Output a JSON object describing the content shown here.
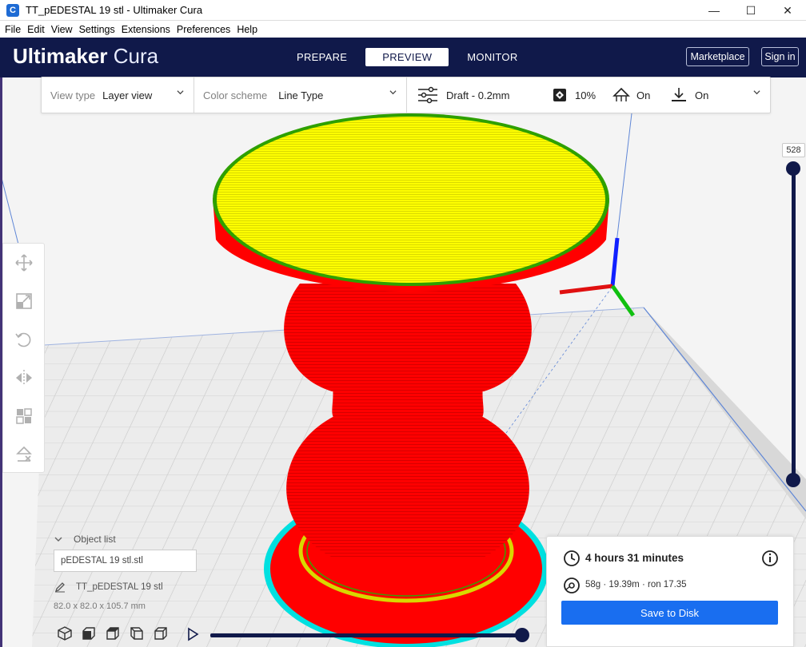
{
  "window": {
    "title": "TT_pEDESTAL 19 stl - Ultimaker Cura",
    "app_icon": "C",
    "minimize": "—",
    "maximize": "☐",
    "close": "✕"
  },
  "menu": [
    "File",
    "Edit",
    "View",
    "Settings",
    "Extensions",
    "Preferences",
    "Help"
  ],
  "header": {
    "brand": "Ultimaker",
    "product": "Cura",
    "tabs": [
      "PREPARE",
      "PREVIEW",
      "MONITOR"
    ],
    "active_tab": "PREVIEW",
    "marketplace": "Marketplace",
    "signin": "Sign in",
    "background": "#10194a"
  },
  "settings_bar": {
    "view_type_label": "View type",
    "view_type_value": "Layer view",
    "color_scheme_label": "Color scheme",
    "color_scheme_value": "Line Type",
    "profile": "Draft - 0.2mm",
    "infill": "10%",
    "support": "On",
    "adhesion": "On"
  },
  "toolbar": {
    "tools": [
      "move-icon",
      "scale-icon",
      "rotate-icon",
      "mirror-icon",
      "per-model-settings-icon",
      "support-blocker-icon"
    ]
  },
  "layer_slider": {
    "current_layer": "528",
    "position_fraction": 1.0
  },
  "object_list": {
    "toggle_label": "Object list",
    "object_name": "pEDESTAL 19 stl.stl",
    "job_name": "TT_pEDESTAL 19 stl",
    "dimensions": "82.0 x 82.0 x 105.7 mm",
    "view_buttons": [
      "3d-view-icon",
      "front-view-icon",
      "top-view-icon",
      "left-view-icon",
      "right-view-icon"
    ]
  },
  "playback": {
    "position_fraction": 1.0
  },
  "print_info": {
    "time": "4 hours 31 minutes",
    "material": "58g · 19.39m · ron 17.35",
    "save_button": "Save to Disk",
    "accent": "#196ef0"
  },
  "colors": {
    "model_red": "#ff0000",
    "top_yellow": "#ffff00",
    "skirt_cyan": "#00ffff",
    "grid_bg": "#e8e8e8"
  }
}
